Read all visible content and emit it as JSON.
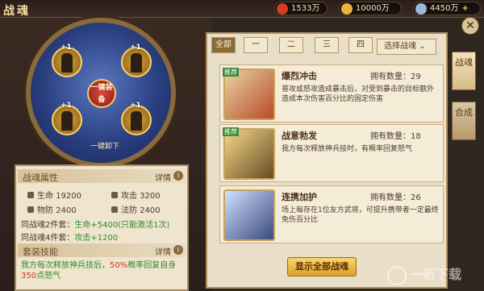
{
  "title": "战魂",
  "currencies": [
    {
      "value": "1533万",
      "color": "#d83a2a"
    },
    {
      "value": "10000万",
      "color": "#e8b63a"
    },
    {
      "value": "4450万",
      "color": "#9ab8e0"
    }
  ],
  "plus": "+",
  "wheel": {
    "equip_button": "一键装备",
    "unequip_button": "一键卸下",
    "slot_badge": "+1"
  },
  "attributes": {
    "title": "战魂属性",
    "details": "详情",
    "info": "i",
    "hp_label": "生命",
    "hp": "19200",
    "atk_label": "攻击",
    "atk": "3200",
    "pdef_label": "物防",
    "pdef": "2400",
    "mdef_label": "法防",
    "mdef": "2400",
    "set2_label": "同战魂2件套：",
    "set2_value": "生命+5400(只能激活1次)",
    "set4_label": "同战魂4件套：",
    "set4_value": "攻击+1200"
  },
  "set_skill": {
    "title": "套装技能",
    "details": "详情",
    "text_a": "我方每次释放神兵技后，",
    "text_pct": "50%",
    "text_b": "概率回复自身",
    "text_num": "350",
    "text_c": "点怒气"
  },
  "tabs": [
    "全部",
    "一",
    "二",
    "三",
    "四"
  ],
  "select_label": "选择战魂",
  "cards": [
    {
      "name": "爆烈冲击",
      "count": "拥有数量：29",
      "badge": "推荐",
      "desc": "普攻或怒攻造成暴击后，对受到暴击的目标额外造成本次伤害百分比的固定伤害"
    },
    {
      "name": "战意勃发",
      "count": "拥有数量：18",
      "badge": "推荐",
      "desc": "我方每次释放神兵技时，有概率回复怒气"
    },
    {
      "name": "连携加护",
      "count": "拥有数量：26",
      "badge": "",
      "desc": "场上每存在1位友方武将，可提升携带者一定最终免伤百分比"
    }
  ],
  "show_all": "显示全部战魂",
  "side_tabs": [
    "战魂",
    "合成"
  ],
  "close": "✕",
  "watermark": "一听下载"
}
